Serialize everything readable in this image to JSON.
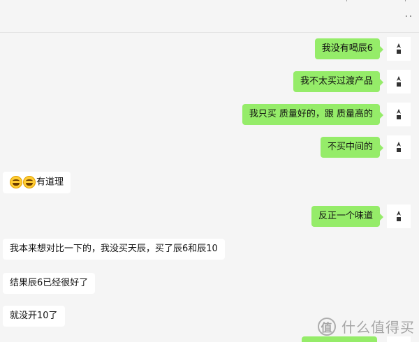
{
  "chat": {
    "messages": [
      {
        "dir": "out",
        "text": "我没有喝辰6"
      },
      {
        "dir": "out",
        "text": "我不太买过渡产品"
      },
      {
        "dir": "out",
        "text": "我只买 质量好的，跟 质量高的"
      },
      {
        "dir": "out",
        "text": "不买中间的"
      },
      {
        "dir": "in",
        "text": "有道理",
        "emoji": "laughing-crying-emoji"
      },
      {
        "dir": "out",
        "text": "反正一个味道"
      },
      {
        "dir": "in",
        "text": "我本来想对比一下的，我没买天辰，买了辰6和辰10"
      },
      {
        "dir": "in",
        "text": "结果辰6已经很好了"
      },
      {
        "dir": "in",
        "text": "就没开10了"
      }
    ]
  },
  "header": {
    "more_label": "··"
  },
  "watermark": {
    "logo_text": "值",
    "text": "什么值得买"
  },
  "colors": {
    "outgoing": "#95ec69",
    "incoming": "#ffffff",
    "background": "#f5f5f5"
  }
}
